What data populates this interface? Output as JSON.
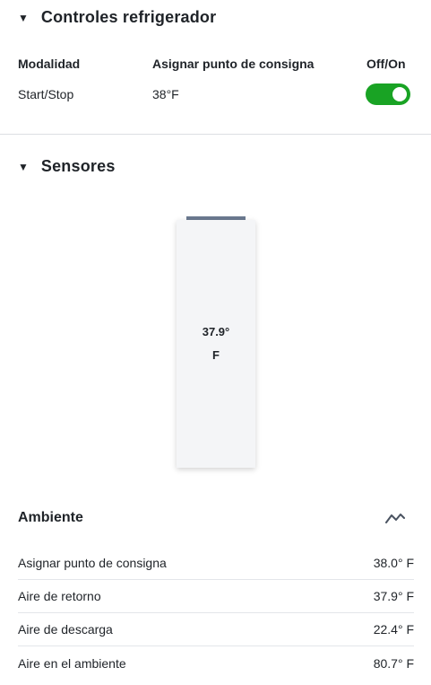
{
  "controls": {
    "title": "Controles refrigerador",
    "headers": {
      "mode": "Modalidad",
      "setpoint": "Asignar punto de consigna",
      "onoff": "Off/On"
    },
    "values": {
      "mode": "Start/Stop",
      "setpoint": "38°F",
      "toggle_on": true
    },
    "toggle_color": "#19a324"
  },
  "sensors": {
    "title": "Sensores",
    "reading_value": "37.9°",
    "reading_unit": "F"
  },
  "ambient": {
    "title": "Ambiente",
    "trend_icon": "trend-line-icon",
    "rows": [
      {
        "label": "Asignar punto de consigna",
        "value": "38.0° F"
      },
      {
        "label": "Aire de retorno",
        "value": "37.9° F"
      },
      {
        "label": "Aire de descarga",
        "value": "22.4° F"
      },
      {
        "label": "Aire en el ambiente",
        "value": "80.7° F"
      }
    ]
  }
}
